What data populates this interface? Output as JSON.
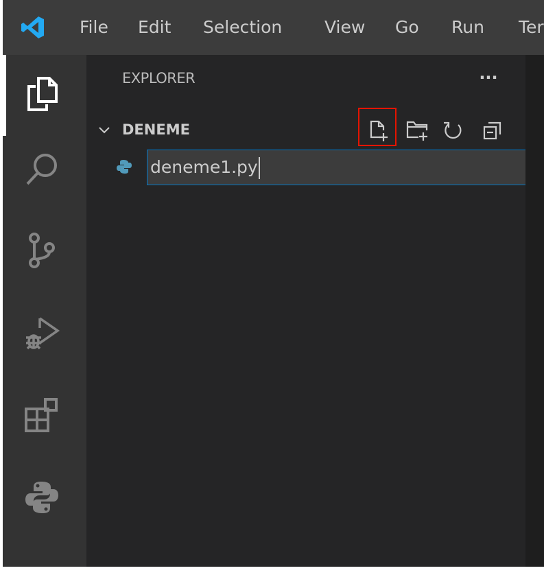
{
  "titlebar": {
    "menu": [
      "File",
      "Edit",
      "Selection",
      "View",
      "Go",
      "Run",
      "Ter"
    ]
  },
  "activity_bar": {
    "icons": [
      "explorer-icon",
      "search-icon",
      "source-control-icon",
      "run-debug-icon",
      "extensions-icon",
      "python-icon"
    ],
    "active": "explorer-icon"
  },
  "sidebar": {
    "title": "EXPLORER",
    "more_actions": "...",
    "folder": {
      "name": "DENEME",
      "actions": [
        "new-file-icon",
        "new-folder-icon",
        "refresh-icon",
        "collapse-all-icon"
      ],
      "highlighted_action": "new-file-icon"
    },
    "new_file_input": {
      "value": "deneme1.py",
      "icon": "python-file-icon"
    }
  },
  "colors": {
    "titlebar_bg": "#3c3c3c",
    "activitybar_bg": "#333333",
    "sidebar_bg": "#252526",
    "editor_bg": "#1e1e1e",
    "accent_blue": "#007acc",
    "vscode_logo_blue": "#23a9f2",
    "highlight_red": "#e51400"
  }
}
